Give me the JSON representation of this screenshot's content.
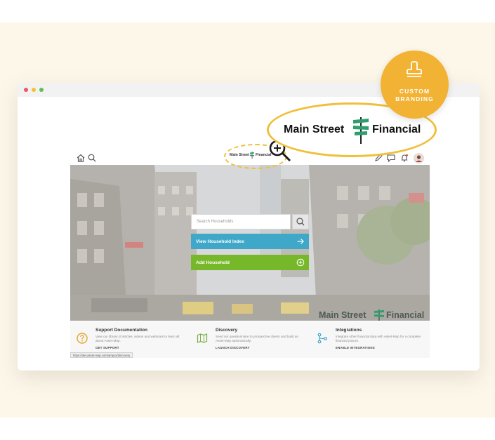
{
  "header": {
    "logo_text_left": "Main Street",
    "logo_text_right": "Financial"
  },
  "hero": {
    "search_placeholder": "Search Households",
    "view_index_label": "View Household Index",
    "add_household_label": "Add Household",
    "logo_text_left": "Main Street",
    "logo_text_right": "Financial"
  },
  "cards": [
    {
      "title": "Support Documentation",
      "desc": "View our library of articles, videos and webinars to learn all about Asset-Map.",
      "link": "GET SUPPORT",
      "icon": "question-circle-icon"
    },
    {
      "title": "Discovery",
      "desc": "Send our questionnaire to prospective clients and build an Asset-Map automatically.",
      "link": "LAUNCH DISCOVERY",
      "icon": "map-icon"
    },
    {
      "title": "Integrations",
      "desc": "Integrate other financial data with Asset-Map for a complete financial picture.",
      "link": "ENABLE INTEGRATIONS",
      "icon": "integrations-icon"
    }
  ],
  "status_url": "https://dev.asset-map.com/ampux/discovery",
  "callout": {
    "logo_text_left": "Main Street",
    "logo_text_right": "Financial"
  },
  "badge": {
    "line1": "CUSTOM",
    "line2": "BRANDING",
    "icon": "stamp-icon"
  },
  "colors": {
    "accent_teal": "#3fa8c9",
    "accent_green": "#77b82a",
    "accent_orange": "#f2b233",
    "logo_green": "#2f9e6e"
  }
}
